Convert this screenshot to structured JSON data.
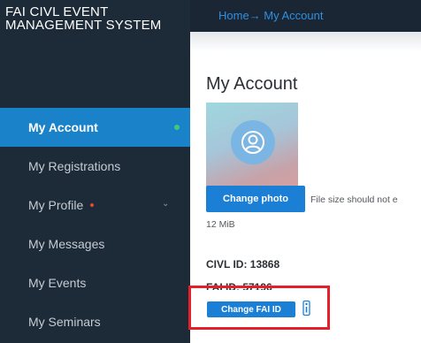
{
  "app": {
    "title": "FAI CIVL EVENT MANAGEMENT SYSTEM"
  },
  "sidebar": {
    "items": [
      {
        "label": "My Account",
        "active": true
      },
      {
        "label": "My Registrations"
      },
      {
        "label": "My Profile",
        "has_required_dot": true,
        "expandable": true
      },
      {
        "label": "My Messages"
      },
      {
        "label": "My Events"
      },
      {
        "label": "My Seminars"
      }
    ]
  },
  "header": {
    "breadcrumb": "Home→ My Account"
  },
  "main": {
    "title": "My Account",
    "change_photo_label": "Change photo",
    "file_hint": "File size should not e",
    "file_size": "12 MiB",
    "civl_id": "CIVL ID: 13868",
    "fai_id": "FAI ID: 57196",
    "change_fai_label": "Change FAI ID"
  },
  "icons": {
    "avatar": "user-icon",
    "info": "info-icon",
    "chevron": "chevron-down-icon"
  },
  "colors": {
    "sidebar": "#1d2a38",
    "accent": "#1a82c9",
    "button": "#1b7fd6",
    "highlight": "#e4202a",
    "active_dot": "#3ec97a",
    "required_dot": "#e2453c"
  }
}
